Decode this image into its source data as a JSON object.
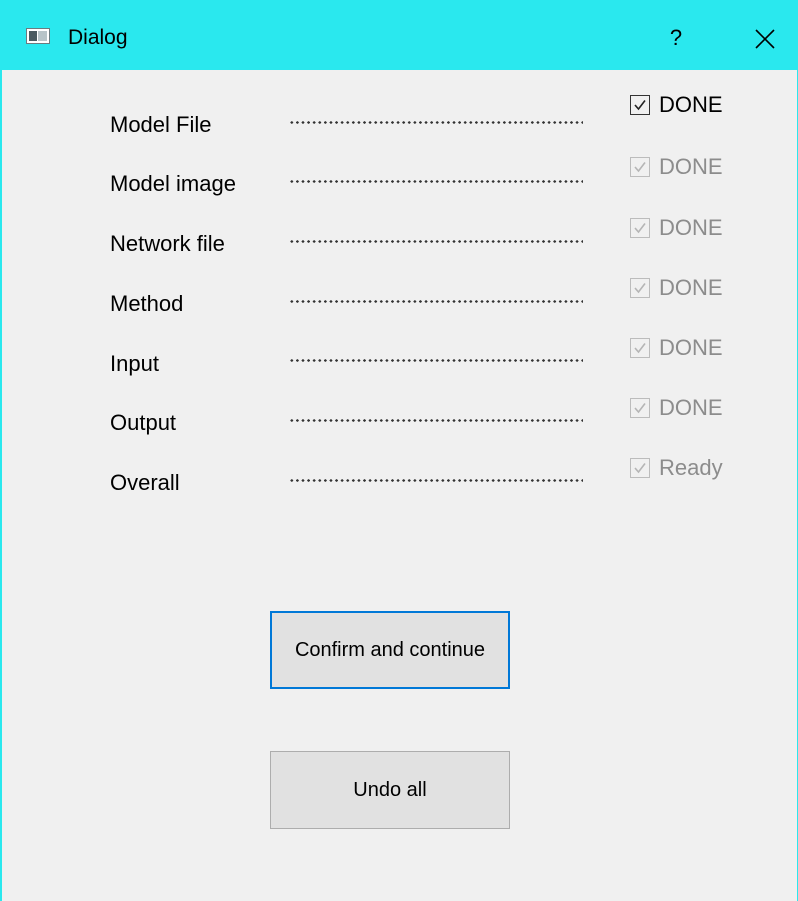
{
  "window": {
    "title": "Dialog",
    "help_label": "?",
    "colors": {
      "titlebar": "#2ae8ee",
      "background": "#f0f0f0",
      "focus_border": "#0078d7"
    }
  },
  "rows": [
    {
      "label": "Model File",
      "status": "DONE",
      "checked": true,
      "enabled": true
    },
    {
      "label": "Model image",
      "status": "DONE",
      "checked": true,
      "enabled": false
    },
    {
      "label": "Network file",
      "status": "DONE",
      "checked": true,
      "enabled": false
    },
    {
      "label": "Method",
      "status": "DONE",
      "checked": true,
      "enabled": false
    },
    {
      "label": "Input",
      "status": "DONE",
      "checked": true,
      "enabled": false
    },
    {
      "label": "Output",
      "status": "DONE",
      "checked": true,
      "enabled": false
    },
    {
      "label": "Overall",
      "status": "Ready",
      "checked": true,
      "enabled": false
    }
  ],
  "buttons": {
    "confirm_label": "Confirm and continue",
    "undo_label": "Undo all"
  },
  "icons": {
    "app": "window-icon",
    "help": "help-icon",
    "close": "close-icon",
    "check": "checkmark-icon"
  }
}
